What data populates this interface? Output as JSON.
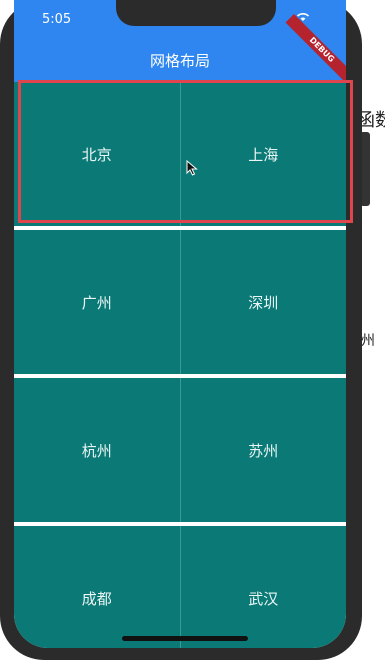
{
  "status_bar": {
    "time": "5:05",
    "debug_label": "DEBUG"
  },
  "app_bar": {
    "title": "网格布局"
  },
  "grid": {
    "rows": [
      {
        "cells": [
          "北京",
          "上海"
        ]
      },
      {
        "cells": [
          "广州",
          "深圳"
        ]
      },
      {
        "cells": [
          "杭州",
          "苏州"
        ]
      },
      {
        "cells": [
          "成都",
          "武汉"
        ]
      }
    ]
  },
  "background": {
    "text_1": "函数",
    "text_2": "州"
  },
  "colors": {
    "app_bar": "#2f86f0",
    "cell": "#0b7a76",
    "highlight": "#e0444c"
  }
}
